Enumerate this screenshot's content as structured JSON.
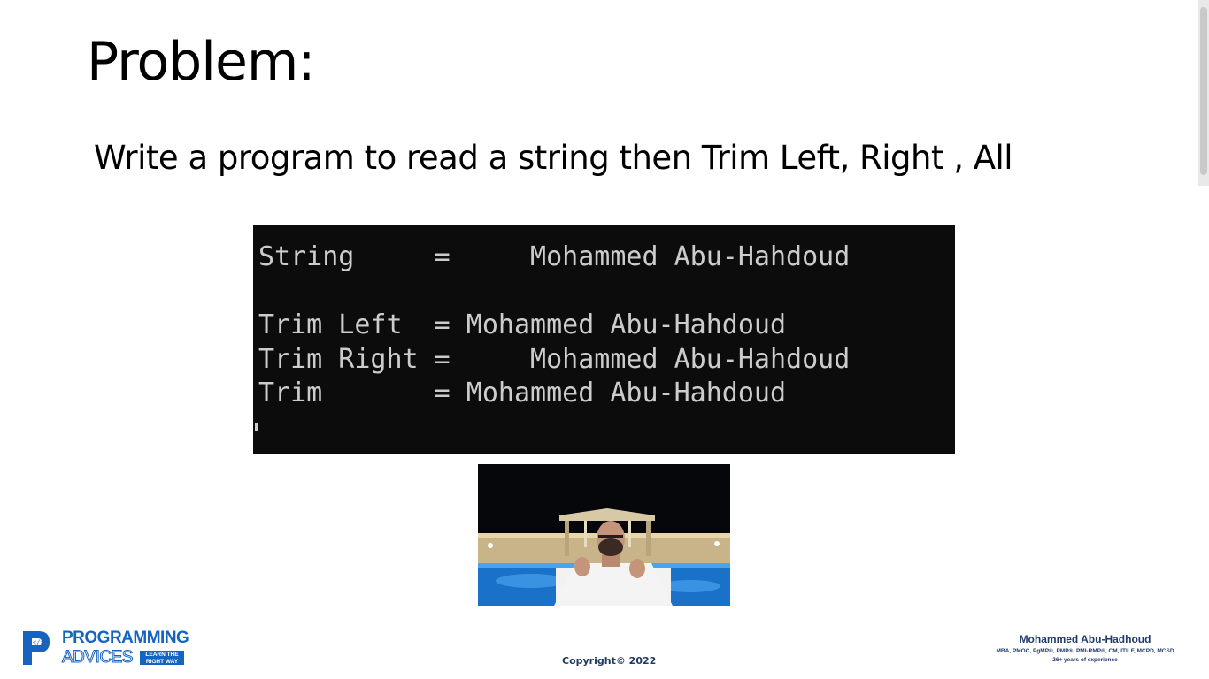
{
  "slide": {
    "title": "Problem:",
    "problem_text": "Write a program to read a string then Trim Left, Right , All"
  },
  "console": {
    "lines": [
      "String     =     Mohammed Abu-Hahdoud",
      "",
      "Trim Left  = Mohammed Abu-Hahdoud",
      "Trim Right =     Mohammed Abu-Hahdoud",
      "Trim       = Mohammed Abu-Hahdoud"
    ],
    "background": "#0c0c0c",
    "text_color": "#cccccc"
  },
  "video": {
    "icons": [
      "presenter-video-icon"
    ]
  },
  "footer": {
    "logo": {
      "word1": "PROGRAMMING",
      "word2": "ADVICES",
      "tagline_line1": "LEARN THE",
      "tagline_line2": "RIGHT WAY",
      "color": "#1565c0"
    },
    "copyright": "Copyright© 2022",
    "author": {
      "name": "Mohammed Abu-Hadhoud",
      "credentials": "MBA, PMOC, PgMP®, PMP®, PMI-RMP®, CM, ITILF, MCPD, MCSD",
      "experience": "26+ years of experience"
    }
  }
}
